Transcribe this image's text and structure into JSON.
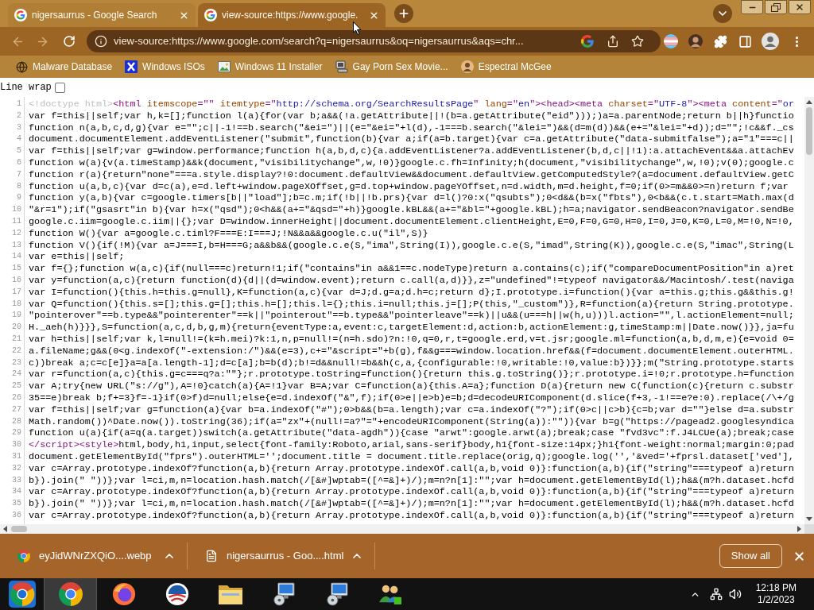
{
  "tabs": [
    {
      "title": "nigersaurrus - Google Search",
      "selected": false
    },
    {
      "title": "view-source:https://www.google.",
      "selected": true
    }
  ],
  "navigation": {
    "back_enabled": false,
    "forward_enabled": false
  },
  "address_bar": {
    "url": "view-source:https://www.google.com/search?q=nigersaurrus&oq=nigersaurrus&aqs=chr..."
  },
  "bookmarks": [
    {
      "label": "Malware Database",
      "kind": "globe"
    },
    {
      "label": "Windows ISOs",
      "kind": "x"
    },
    {
      "label": "Windows 11 Installer",
      "kind": "picture"
    },
    {
      "label": "Gay Porn Sex Movie...",
      "kind": "computer"
    },
    {
      "label": "Espectral McGee",
      "kind": "avatar"
    }
  ],
  "line_wrap": {
    "label": "Line wrap",
    "checked": false
  },
  "source_lines": [
    {
      "number": "1",
      "segments": [
        {
          "kind": "doctype",
          "text": "<!doctype html>"
        },
        {
          "kind": "tag",
          "text": "<html "
        },
        {
          "kind": "attribute",
          "text": "itemscope"
        },
        {
          "kind": "tag",
          "text": "=\"\" "
        },
        {
          "kind": "attribute",
          "text": "itemtype"
        },
        {
          "kind": "tag",
          "text": "=\""
        },
        {
          "kind": "value",
          "text": "http://schema.org/SearchResultsPage"
        },
        {
          "kind": "tag",
          "text": "\" "
        },
        {
          "kind": "attribute",
          "text": "lang"
        },
        {
          "kind": "tag",
          "text": "=\""
        },
        {
          "kind": "value",
          "text": "en"
        },
        {
          "kind": "tag",
          "text": "\"><head><meta "
        },
        {
          "kind": "attribute",
          "text": "charset"
        },
        {
          "kind": "tag",
          "text": "=\""
        },
        {
          "kind": "value",
          "text": "UTF-8"
        },
        {
          "kind": "tag",
          "text": "\"><meta "
        },
        {
          "kind": "attribute",
          "text": "content"
        },
        {
          "kind": "tag",
          "text": "=\""
        },
        {
          "kind": "value",
          "text": "or"
        }
      ]
    },
    {
      "number": "2",
      "segments": [
        {
          "kind": "text",
          "text": "var f=this||self;var h,k=[];function l(a){for(var b;a&&(!a.getAttribute||!(b=a.getAttribute(\"eid\")));)a=a.parentNode;return b||h}functio"
        }
      ]
    },
    {
      "number": "3",
      "segments": [
        {
          "kind": "text",
          "text": "function n(a,b,c,d,g){var e=\"\";c||-1!==b.search(\"&ei=\")||(e=\"&ei=\"+l(d),-1===b.search(\"&lei=\")&&(d=m(d))&&(e+=\"&lei=\"+d));d=\"\";!c&&f._cs"
        }
      ]
    },
    {
      "number": "4",
      "segments": [
        {
          "kind": "text",
          "text": "document.documentElement.addEventListener(\"submit\",function(b){var a;if(a=b.target){var c=a.getAttribute(\"data-submitfalse\");a=\"1\"===c||"
        }
      ]
    },
    {
      "number": "5",
      "segments": [
        {
          "kind": "text",
          "text": "var f=this||self;var g=window.performance;function h(a,b,d,c){a.addEventListener?a.addEventListener(b,d,c||!1):a.attachEvent&&a.attachEv"
        }
      ]
    },
    {
      "number": "6",
      "segments": [
        {
          "kind": "text",
          "text": "function w(a){v(a.timeStamp)&&k(document,\"visibilitychange\",w,!0)}google.c.fh=Infinity;h(document,\"visibilitychange\",w,!0);v(0);google.c"
        }
      ]
    },
    {
      "number": "7",
      "segments": [
        {
          "kind": "text",
          "text": "function r(a){return\"none\"===a.style.display?!0:document.defaultView&&document.defaultView.getComputedStyle?(a=document.defaultView.getC"
        }
      ]
    },
    {
      "number": "8",
      "segments": [
        {
          "kind": "text",
          "text": "function u(a,b,c){var d=c(a),e=d.left+window.pageXOffset,g=d.top+window.pageYOffset,n=d.width,m=d.height,f=0;if(0>=m&&0>=n)return f;var"
        }
      ]
    },
    {
      "number": "9",
      "segments": [
        {
          "kind": "text",
          "text": "function y(a,b){var c=google.timers[b||\"load\"];b=c.m;if(!b||!b.prs){var d=l()?0:x(\"qsubts\");0<d&&(b=x(\"fbts\"),0<b&&(c.t.start=Math.max(d"
        }
      ]
    },
    {
      "number": "10",
      "segments": [
        {
          "kind": "text",
          "text": "\"&r=1\");if(\"gsasrt\"in b){var h=x(\"qsd\");0<h&&(a+=\"&qsd=\"+h)}google.kBL&&(a+=\"&bl=\"+google.kBL);h=a;navigator.sendBeacon?navigator.sendBe"
        }
      ]
    },
    {
      "number": "11",
      "segments": [
        {
          "kind": "text",
          "text": "google.c.iim=google.c.iim||{};var D=window.innerHeight||document.documentElement.clientHeight,E=0,F=0,G=0,H=0,I=0,J=0,K=0,L=0,M=!0,N=!0,"
        }
      ]
    },
    {
      "number": "12",
      "segments": [
        {
          "kind": "text",
          "text": "function W(){var a=google.c.timl?F===E:I===J;!N&&a&&google.c.u(\"il\",S)}"
        }
      ]
    },
    {
      "number": "13",
      "segments": [
        {
          "kind": "text",
          "text": "function V(){if(!M){var a=J===I,b=H===G;a&&b&&(google.c.e(S,\"ima\",String(I)),google.c.e(S,\"imad\",String(K)),google.c.e(S,\"imac\",String(L"
        }
      ]
    },
    {
      "number": "14",
      "segments": [
        {
          "kind": "text",
          "text": "var e=this||self;"
        }
      ]
    },
    {
      "number": "15",
      "segments": [
        {
          "kind": "text",
          "text": "var f={};function w(a,c){if(null===c)return!1;if(\"contains\"in a&&1==c.nodeType)return a.contains(c);if(\"compareDocumentPosition\"in a)ret"
        }
      ]
    },
    {
      "number": "16",
      "segments": [
        {
          "kind": "text",
          "text": "var y=function(a,c){return function(d){d||(d=window.event);return c.call(a,d)}},z=\"undefined\"!=typeof navigator&&/Macintosh/.test(naviga"
        }
      ]
    },
    {
      "number": "17",
      "segments": [
        {
          "kind": "text",
          "text": "var I=function(){this.h=this.g=null},K=function(a,c){var d=J;d.g=a;d.h=c;return d};I.prototype.i=function(){var a=this.g;this.g&&this.g!"
        }
      ]
    },
    {
      "number": "18",
      "segments": [
        {
          "kind": "text",
          "text": "var Q=function(){this.s=[];this.g=[];this.h=[];this.l={};this.i=null;this.j=[];P(this,\"_custom\")},R=function(a){return String.prototype."
        }
      ]
    },
    {
      "number": "19",
      "segments": [
        {
          "kind": "text",
          "text": "\"pointerover\"==b.type&&\"pointerenter\"==k||\"pointerout\"==b.type&&\"pointerleave\"==k)||u&&(u===h||w(h,u)))l.action=\"\",l.actionElement=null;"
        }
      ]
    },
    {
      "number": "20",
      "segments": [
        {
          "kind": "text",
          "text": "H._aeh(h)}}},S=function(a,c,d,b,g,m){return{eventType:a,event:c,targetElement:d,action:b,actionElement:g,timeStamp:m||Date.now()}},ja=fu"
        }
      ]
    },
    {
      "number": "21",
      "segments": [
        {
          "kind": "text",
          "text": "var h=this||self;var k,l=null!=(k=h.mei)?k:1,n,p=null!=(n=h.sdo)?n:!0,q=0,r,t=google.erd,v=t.jsr;google.ml=function(a,b,d,m,e){e=void 0="
        }
      ]
    },
    {
      "number": "22",
      "segments": [
        {
          "kind": "text",
          "text": "a.fileName;g&&(0<g.indexOf(\"-extension:/\")&&(e=3),c+=\"&script=\"+b(g),f&&g===window.location.href&&(f=document.documentElement.outerHTML."
        }
      ]
    },
    {
      "number": "23",
      "segments": [
        {
          "kind": "text",
          "text": "c))break a;c=c[e]}a=a[a.length-1];d=c[a];b=b(d);b!=d&&null!=b&&h(c,a,{configurable:!0,writable:!0,value:b})}};m(\"String.prototype.starts"
        }
      ]
    },
    {
      "number": "24",
      "segments": [
        {
          "kind": "text",
          "text": "var r=function(a,c){this.g=c===q?a:\"\"};r.prototype.toString=function(){return this.g.toString()};r.prototype.i=!0;r.prototype.h=function"
        }
      ]
    },
    {
      "number": "25",
      "segments": [
        {
          "kind": "text",
          "text": "var A;try{new URL(\"s://g\"),A=!0}catch(a){A=!1}var B=A;var C=function(a){this.A=a};function D(a){return new C(function(c){return c.substr"
        }
      ]
    },
    {
      "number": "26",
      "segments": [
        {
          "kind": "text",
          "text": "35==e)break b;f+=3}f=-1}if(0>f)d=null;else{e=d.indexOf(\"&\",f);if(0>e||e>b)e=b;d=decodeURIComponent(d.slice(f+3,-1!==e?e:0).replace(/\\+/g"
        }
      ]
    },
    {
      "number": "27",
      "segments": [
        {
          "kind": "text",
          "text": "var f=this||self;var g=function(a){var b=a.indexOf(\"#\");0>b&&(b=a.length);var c=a.indexOf(\"?\");if(0>c||c>b){c=b;var d=\"\"}else d=a.substr"
        }
      ]
    },
    {
      "number": "28",
      "segments": [
        {
          "kind": "text",
          "text": "Math.random())^Date.now()).toString(36);if(a=\"zx\"+(null!=a?\"=\"+encodeURIComponent(String(a)):\"\")){var b=g(\"https://pagead2.googlesyndica"
        }
      ]
    },
    {
      "number": "29",
      "segments": [
        {
          "kind": "text",
          "text": "function u(a){if(a=q(a.target))switch(a.getAttribute(\"data-agdh\")){case \"arwt\":google.arwt(a);break;case \"fvd3vc\":f.J4LCUe(a);break;case"
        }
      ]
    },
    {
      "number": "30",
      "segments": [
        {
          "kind": "tag",
          "text": "</script><style>"
        },
        {
          "kind": "text",
          "text": "html,body,h1,input,select{font-family:Roboto,arial,sans-serif}body,h1{font-size:14px;}h1{font-weight:normal;margin:0;pad"
        }
      ]
    },
    {
      "number": "31",
      "segments": [
        {
          "kind": "text",
          "text": "document.getElementById(\"fprs\").outerHTML='';document.title = document.title.replace(orig,q);google.log('','&ved='+fprsl.dataset['ved'],"
        }
      ]
    },
    {
      "number": "32",
      "segments": [
        {
          "kind": "text",
          "text": "var c=Array.prototype.indexOf?function(a,b){return Array.prototype.indexOf.call(a,b,void 0)}:function(a,b){if(\"string\"===typeof a)return"
        }
      ]
    },
    {
      "number": "33",
      "segments": [
        {
          "kind": "text",
          "text": "b}).join(\" \"))};var l=ci,m,n=location.hash.match(/[&#]wptab=([^=&]+)/);m=n?n[1]:\"\";var h=document.getElementById(l);h&&(m?h.dataset.hcfd"
        }
      ]
    },
    {
      "number": "34",
      "segments": [
        {
          "kind": "text",
          "text": "var c=Array.prototype.indexOf?function(a,b){return Array.prototype.indexOf.call(a,b,void 0)}:function(a,b){if(\"string\"===typeof a)return"
        }
      ]
    },
    {
      "number": "35",
      "segments": [
        {
          "kind": "text",
          "text": "b}).join(\" \"))};var l=ci,m,n=location.hash.match(/[&#]wptab=([^=&]+)/);m=n?n[1]:\"\";var h=document.getElementById(l);h&&(m?h.dataset.hcfd"
        }
      ]
    },
    {
      "number": "36",
      "segments": [
        {
          "kind": "text",
          "text": "var c=Array.prototype.indexOf?function(a,b){return Array.prototype.indexOf.call(a,b,void 0)}:function(a,b){if(\"string\"===typeof a)return"
        }
      ]
    }
  ],
  "downloads": [
    {
      "filename": "eyJidWNrZXQiO....webp",
      "kind": "browser"
    },
    {
      "filename": "nigersaurrus - Goo....html",
      "kind": "file"
    }
  ],
  "show_all": "Show all",
  "taskbar": {
    "apps": [
      {
        "kind": "browser",
        "selected": true
      },
      {
        "kind": "ring",
        "selected": false
      },
      {
        "kind": "circle-logo",
        "selected": false
      },
      {
        "kind": "folder",
        "selected": false
      },
      {
        "kind": "computer",
        "selected": false
      },
      {
        "kind": "computer",
        "selected": false
      },
      {
        "kind": "people",
        "selected": false
      }
    ],
    "time": "12:18 PM",
    "date": "1/2/2023"
  }
}
